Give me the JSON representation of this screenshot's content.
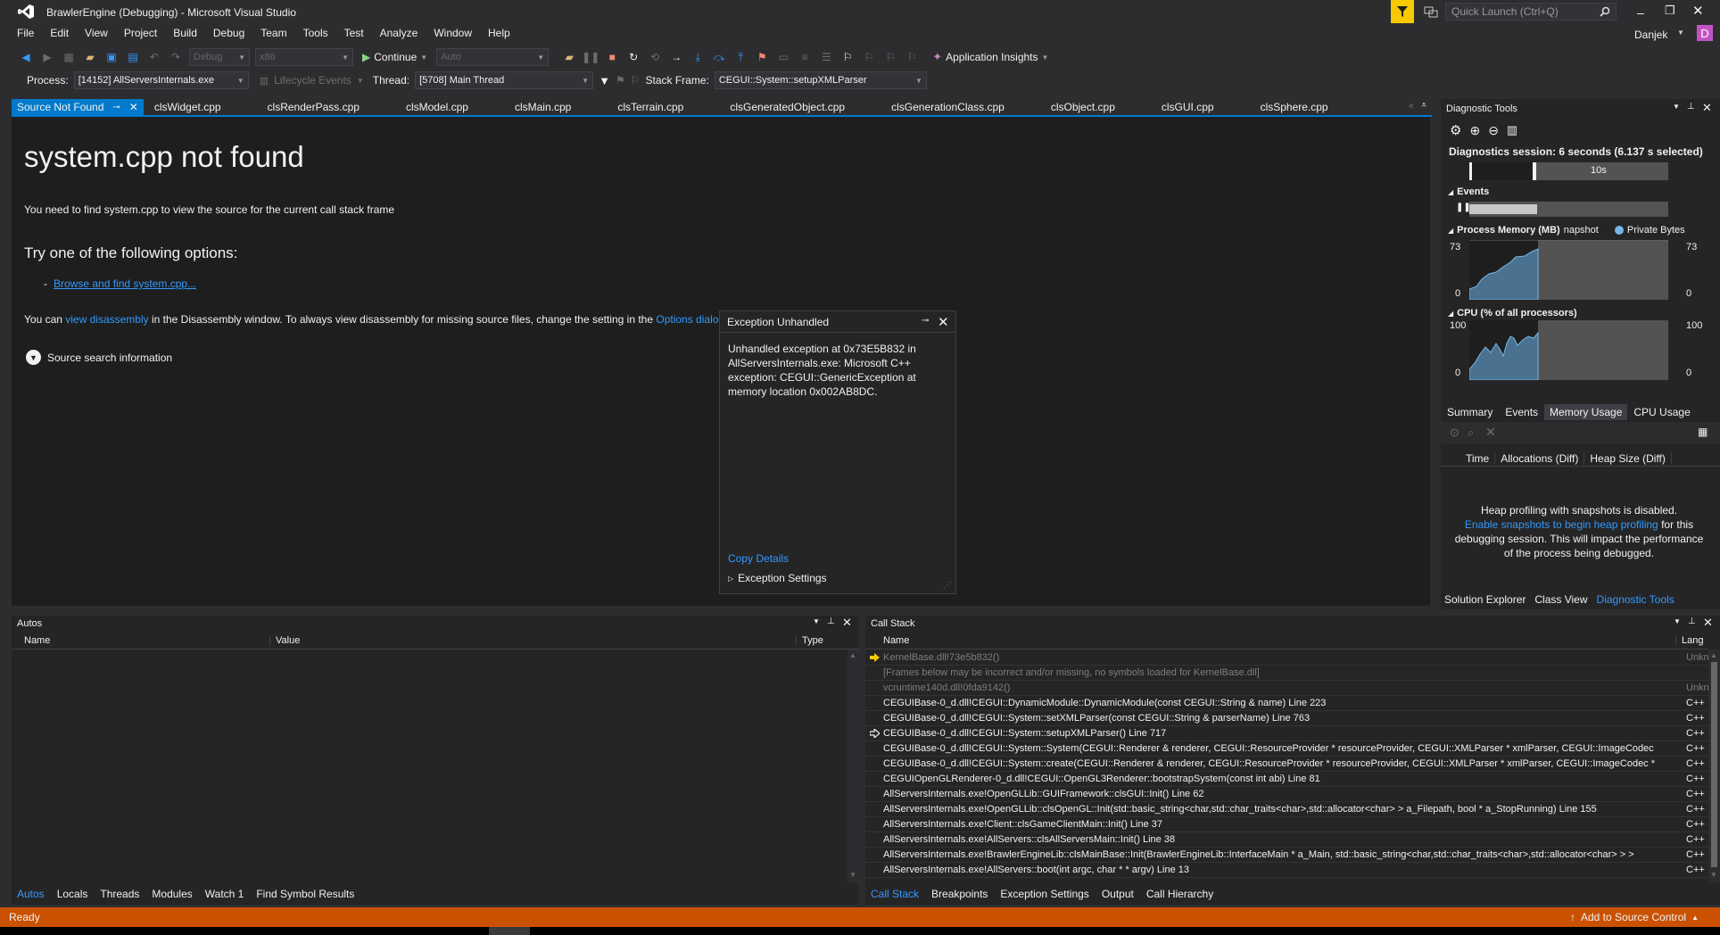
{
  "window": {
    "title": "BrawlerEngine (Debugging) - Microsoft Visual Studio",
    "quick_launch_placeholder": "Quick Launch (Ctrl+Q)",
    "user": "Danjek",
    "avatar_letter": "D"
  },
  "menu": [
    "File",
    "Edit",
    "View",
    "Project",
    "Build",
    "Debug",
    "Team",
    "Tools",
    "Test",
    "Analyze",
    "Window",
    "Help"
  ],
  "toolbar": {
    "config": "Debug",
    "platform": "x86",
    "continue_label": "Continue",
    "target": "Auto",
    "insights_label": "Application Insights"
  },
  "debugbar": {
    "process_label": "Process:",
    "process_value": "[14152] AllServersInternals.exe",
    "lifecycle_label": "Lifecycle Events",
    "thread_label": "Thread:",
    "thread_value": "[5708] Main Thread",
    "stack_frame_label": "Stack Frame:",
    "stack_frame_value": "CEGUI::System::setupXMLParser"
  },
  "tabs": {
    "active": "Source Not Found",
    "items": [
      "clsWidget.cpp",
      "clsRenderPass.cpp",
      "clsModel.cpp",
      "clsMain.cpp",
      "clsTerrain.cpp",
      "clsGeneratedObject.cpp",
      "clsGenerationClass.cpp",
      "clsObject.cpp",
      "clsGUI.cpp",
      "clsSphere.cpp"
    ]
  },
  "source_not_found": {
    "heading": "system.cpp not found",
    "message": "You need to find system.cpp to view the source for the current call stack frame",
    "options_heading": "Try one of the following options:",
    "browse_link": "Browse and find system.cpp...",
    "disasm_prefix": "You can ",
    "disasm_link": "view disassembly",
    "disasm_middle": " in the Disassembly window. To always view disassembly for missing source files, change the setting in the ",
    "options_link": "Options dialog",
    "search_info": "Source search information"
  },
  "exception": {
    "title": "Exception Unhandled",
    "message": "Unhandled exception at 0x73E5B832 in AllServersInternals.exe: Microsoft C++ exception: CEGUI::GenericException at memory location 0x002AB8DC.",
    "copy_details": "Copy Details",
    "settings": "Exception Settings"
  },
  "diagnostics": {
    "title": "Diagnostic Tools",
    "session": "Diagnostics session: 6 seconds (6.137 s selected)",
    "timeline_label": "10s",
    "events_label": "Events",
    "memory_label": "Process Memory (MB)",
    "snapshot_label": "napshot",
    "private_bytes_label": "Private Bytes",
    "mem_max": "73",
    "mem_min": "0",
    "cpu_label": "CPU (% of all processors)",
    "cpu_max": "100",
    "cpu_min": "0",
    "tabs": [
      "Summary",
      "Events",
      "Memory Usage",
      "CPU Usage"
    ],
    "active_tab": "Memory Usage",
    "columns": [
      "Time",
      "Allocations (Diff)",
      "Heap Size (Diff)"
    ],
    "heap_msg1": "Heap profiling with snapshots is disabled.",
    "heap_link": "Enable snapshots to begin heap profiling",
    "heap_msg2": " for this debugging session. This will impact the performance of the process being debugged.",
    "bottom_tabs": [
      "Solution Explorer",
      "Class View",
      "Diagnostic Tools"
    ]
  },
  "autos": {
    "title": "Autos",
    "columns": [
      "Name",
      "Value",
      "Type"
    ],
    "tabs": [
      "Autos",
      "Locals",
      "Threads",
      "Modules",
      "Watch 1",
      "Find Symbol Results"
    ]
  },
  "callstack": {
    "title": "Call Stack",
    "columns": [
      "Name",
      "Lang"
    ],
    "rows": [
      {
        "name": "KernelBase.dll!73e5b832()",
        "lang": "Unkn",
        "dim": true,
        "marker": "current"
      },
      {
        "name": "[Frames below may be incorrect and/or missing, no symbols loaded for KernelBase.dll]",
        "lang": "",
        "dim": true,
        "marker": ""
      },
      {
        "name": "vcruntime140d.dll!0fda9142()",
        "lang": "Unkn",
        "dim": true,
        "marker": ""
      },
      {
        "name": "CEGUIBase-0_d.dll!CEGUI::DynamicModule::DynamicModule(const CEGUI::String & name) Line 223",
        "lang": "C++",
        "dim": false,
        "marker": ""
      },
      {
        "name": "CEGUIBase-0_d.dll!CEGUI::System::setXMLParser(const CEGUI::String & parserName) Line 763",
        "lang": "C++",
        "dim": false,
        "marker": ""
      },
      {
        "name": "CEGUIBase-0_d.dll!CEGUI::System::setupXMLParser() Line 717",
        "lang": "C++",
        "dim": false,
        "marker": "frame"
      },
      {
        "name": "CEGUIBase-0_d.dll!CEGUI::System::System(CEGUI::Renderer & renderer, CEGUI::ResourceProvider * resourceProvider, CEGUI::XMLParser * xmlParser, CEGUI::ImageCodec",
        "lang": "C++",
        "dim": false,
        "marker": ""
      },
      {
        "name": "CEGUIBase-0_d.dll!CEGUI::System::create(CEGUI::Renderer & renderer, CEGUI::ResourceProvider * resourceProvider, CEGUI::XMLParser * xmlParser, CEGUI::ImageCodec *",
        "lang": "C++",
        "dim": false,
        "marker": ""
      },
      {
        "name": "CEGUIOpenGLRenderer-0_d.dll!CEGUI::OpenGL3Renderer::bootstrapSystem(const int abi) Line 81",
        "lang": "C++",
        "dim": false,
        "marker": ""
      },
      {
        "name": "AllServersInternals.exe!OpenGLLib::GUIFramework::clsGUI::Init() Line 62",
        "lang": "C++",
        "dim": false,
        "marker": ""
      },
      {
        "name": "AllServersInternals.exe!OpenGLLib::clsOpenGL::Init(std::basic_string<char,std::char_traits<char>,std::allocator<char> > a_Filepath, bool * a_StopRunning) Line 155",
        "lang": "C++",
        "dim": false,
        "marker": ""
      },
      {
        "name": "AllServersInternals.exe!Client::clsGameClientMain::Init() Line 37",
        "lang": "C++",
        "dim": false,
        "marker": ""
      },
      {
        "name": "AllServersInternals.exe!AllServers::clsAllServersMain::Init() Line 38",
        "lang": "C++",
        "dim": false,
        "marker": ""
      },
      {
        "name": "AllServersInternals.exe!BrawlerEngineLib::clsMainBase::Init(BrawlerEngineLib::InterfaceMain * a_Main, std::basic_string<char,std::char_traits<char>,std::allocator<char> > >",
        "lang": "C++",
        "dim": false,
        "marker": ""
      },
      {
        "name": "AllServersInternals.exe!AllServers::boot(int argc, char * * argv) Line 13",
        "lang": "C++",
        "dim": false,
        "marker": ""
      }
    ],
    "tabs": [
      "Call Stack",
      "Breakpoints",
      "Exception Settings",
      "Output",
      "Call Hierarchy"
    ]
  },
  "status": {
    "text": "Ready",
    "source_control": "Add to Source Control"
  },
  "colors": {
    "accent": "#007acc",
    "status_bar": "#ca5100",
    "link": "#3399ff",
    "notification": "#f8c800"
  }
}
